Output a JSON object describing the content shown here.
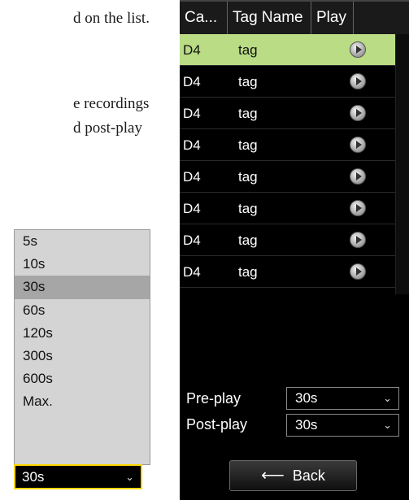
{
  "document": {
    "fragments": [
      "d on the list.",
      "e recordings",
      "d   post-play"
    ]
  },
  "dropdown": {
    "options": [
      "5s",
      "10s",
      "30s",
      "60s",
      "120s",
      "300s",
      "600s",
      "Max."
    ],
    "selected": "30s",
    "selected_index": 2,
    "highlight_color": "#a6a6a6",
    "focus_border_color": "#ffd700"
  },
  "panel": {
    "columns": [
      "Ca...",
      "Tag Name",
      "Play"
    ],
    "rows": [
      {
        "camera": "D4",
        "tag": "tag"
      },
      {
        "camera": "D4",
        "tag": "tag"
      },
      {
        "camera": "D4",
        "tag": "tag"
      },
      {
        "camera": "D4",
        "tag": "tag"
      },
      {
        "camera": "D4",
        "tag": "tag"
      },
      {
        "camera": "D4",
        "tag": "tag"
      },
      {
        "camera": "D4",
        "tag": "tag"
      },
      {
        "camera": "D4",
        "tag": "tag"
      }
    ],
    "active_row_color": "#b9dc84",
    "pre_play_label": "Pre-play",
    "pre_play_value": "30s",
    "post_play_label": "Post-play",
    "post_play_value": "30s",
    "back_label": "Back"
  }
}
